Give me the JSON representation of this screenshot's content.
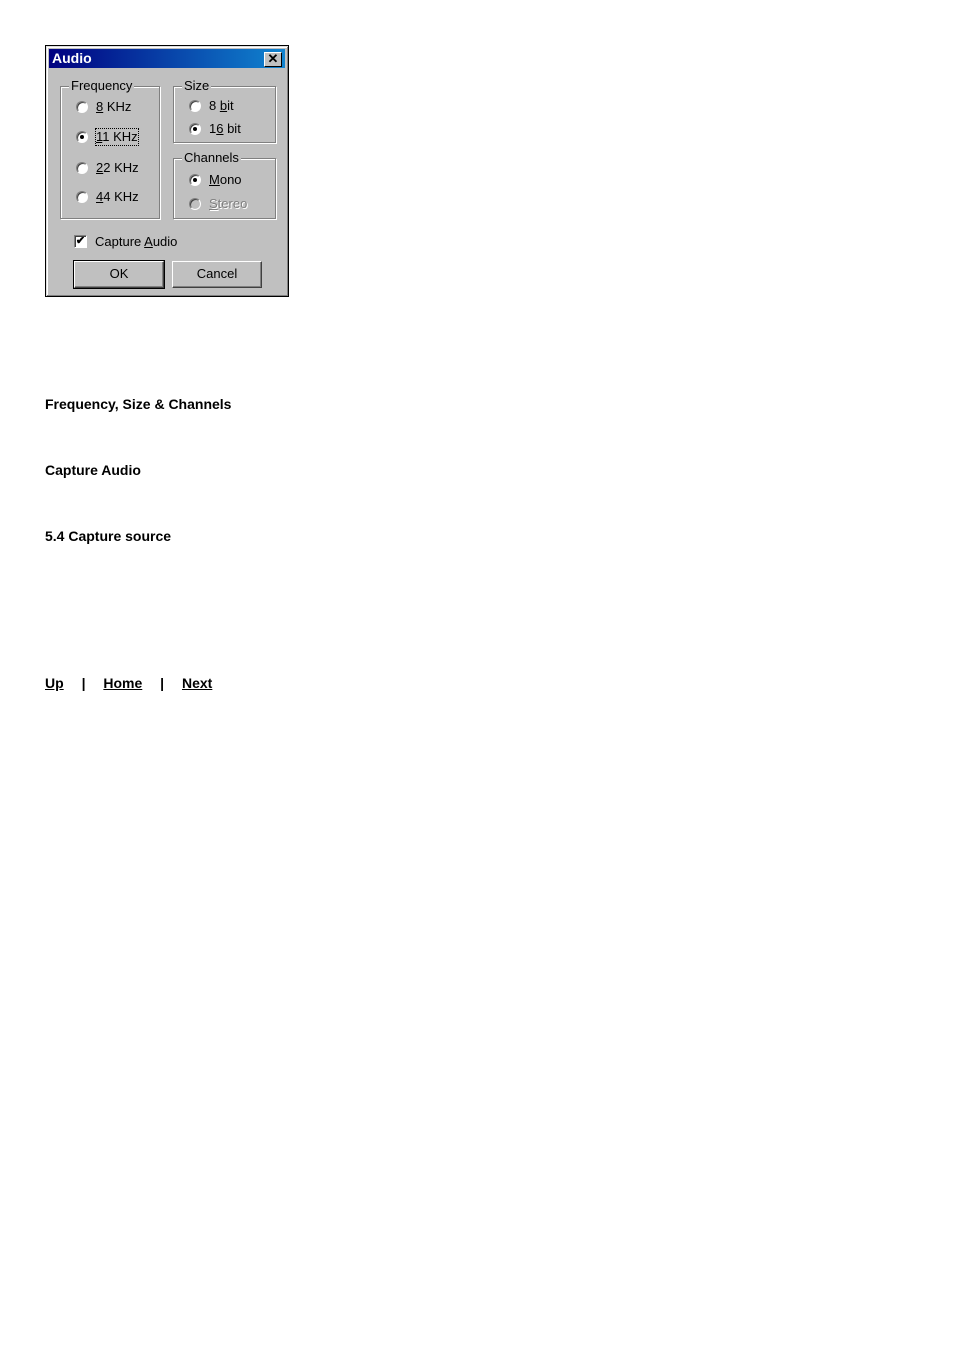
{
  "dialog": {
    "title": "Audio",
    "close_icon": "close-icon",
    "frequency": {
      "label": "Frequency",
      "options": [
        {
          "pre": "",
          "key": "8",
          "post": " KHz",
          "checked": false
        },
        {
          "pre": "",
          "key": "1",
          "post": "1 KHz",
          "checked": true
        },
        {
          "pre": "",
          "key": "2",
          "post": "2 KHz",
          "checked": false
        },
        {
          "pre": "",
          "key": "4",
          "post": "4 KHz",
          "checked": false
        }
      ]
    },
    "size": {
      "label": "Size",
      "options": [
        {
          "pre": "8 ",
          "key": "b",
          "post": "it",
          "checked": false
        },
        {
          "pre": "1",
          "key": "6",
          "post": " bit",
          "checked": true
        }
      ]
    },
    "channels": {
      "label": "Channels",
      "options": [
        {
          "pre": "",
          "key": "M",
          "post": "ono",
          "checked": true,
          "disabled": false
        },
        {
          "pre": "",
          "key": "S",
          "post": "tereo",
          "checked": false,
          "disabled": true
        }
      ]
    },
    "capture_audio": {
      "pre": "Capture ",
      "key": "A",
      "post": "udio",
      "checked": true,
      "check_glyph": "✔"
    },
    "ok_label": "OK",
    "cancel_label": "Cancel"
  },
  "headings": {
    "h1": "Frequency, Size & Channels",
    "h2": "Capture Audio",
    "h3": "5.4 Capture source"
  },
  "nav": {
    "up": "Up",
    "sep": "|",
    "home": "Home",
    "next": "Next"
  }
}
